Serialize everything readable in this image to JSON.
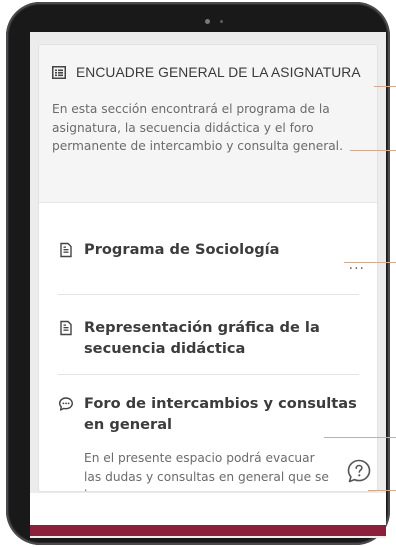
{
  "section": {
    "title": "ENCUADRE GENERAL DE LA ASIGNATURA",
    "description": "En esta sección encontrará el programa de la asignatura, la secuencia didáctica y el foro permanente de intercambio y consulta general."
  },
  "items": [
    {
      "label": "Programa de Sociología",
      "icon": "document-icon",
      "menu": "..."
    },
    {
      "label": "Representación gráfica de la secuencia didáctica",
      "icon": "document-icon"
    },
    {
      "label": "Foro de intercambios y consultas en general",
      "icon": "chat-bubble-icon",
      "description": "En el presente espacio podrá evacuar las dudas y consultas en general que se le"
    }
  ],
  "help": {
    "icon": "question-bubble-icon"
  },
  "colors": {
    "accent": "#8c1f3b",
    "leader": "#d7a890"
  }
}
